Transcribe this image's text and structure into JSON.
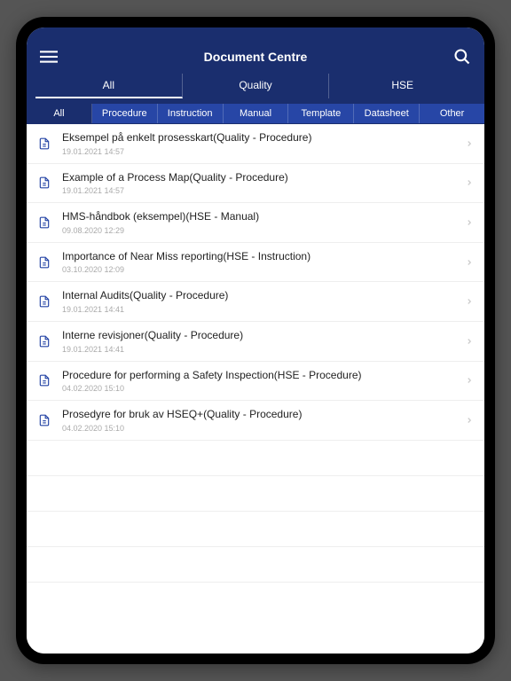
{
  "header": {
    "title": "Document Centre"
  },
  "primaryTabs": [
    {
      "label": "All",
      "active": true
    },
    {
      "label": "Quality",
      "active": false
    },
    {
      "label": "HSE",
      "active": false
    }
  ],
  "secondaryTabs": [
    {
      "label": "All",
      "active": true
    },
    {
      "label": "Procedure",
      "active": false
    },
    {
      "label": "Instruction",
      "active": false
    },
    {
      "label": "Manual",
      "active": false
    },
    {
      "label": "Template",
      "active": false
    },
    {
      "label": "Datasheet",
      "active": false
    },
    {
      "label": "Other",
      "active": false
    }
  ],
  "documents": [
    {
      "title": "Eksempel på enkelt prosesskart(Quality - Procedure)",
      "date": "19.01.2021 14:57"
    },
    {
      "title": "Example of a Process Map(Quality - Procedure)",
      "date": "19.01.2021 14:57"
    },
    {
      "title": "HMS-håndbok (eksempel)(HSE - Manual)",
      "date": "09.08.2020 12:29"
    },
    {
      "title": "Importance of Near Miss reporting(HSE - Instruction)",
      "date": "03.10.2020 12:09"
    },
    {
      "title": "Internal Audits(Quality - Procedure)",
      "date": "19.01.2021 14:41"
    },
    {
      "title": "Interne revisjoner(Quality - Procedure)",
      "date": "19.01.2021 14:41"
    },
    {
      "title": "Procedure for performing a Safety Inspection(HSE - Procedure)",
      "date": "04.02.2020 15:10"
    },
    {
      "title": "Prosedyre for bruk av HSEQ+(Quality - Procedure)",
      "date": "04.02.2020 15:10"
    }
  ],
  "colors": {
    "headerBg": "#1a2e6e",
    "tabBg": "#2746a6"
  }
}
